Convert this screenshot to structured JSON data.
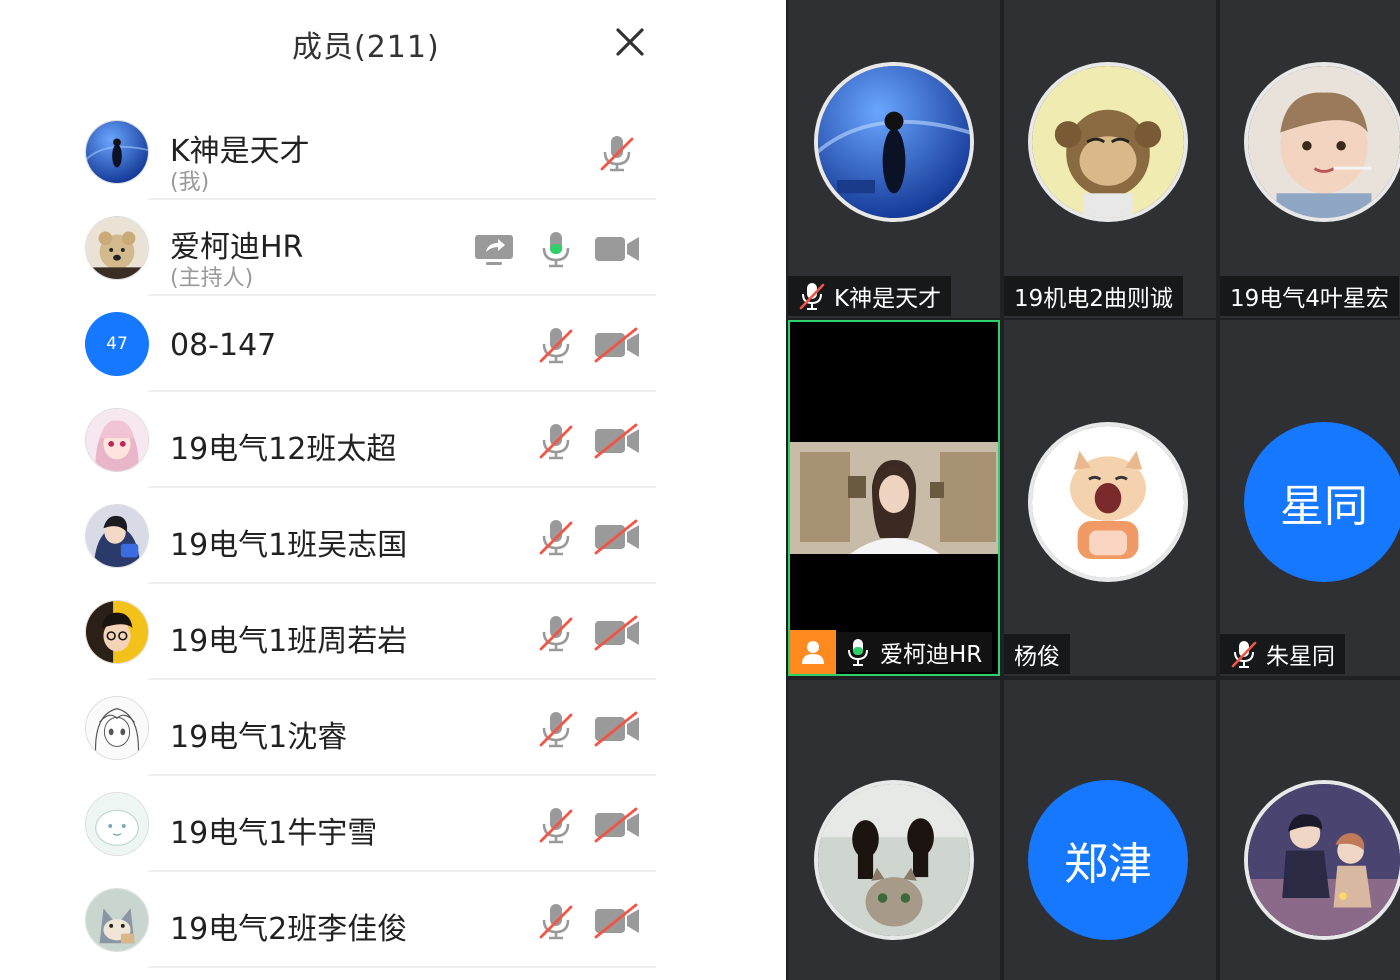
{
  "members_panel": {
    "title": "成员(211)",
    "rows": [
      {
        "name": "K神是天才",
        "role": "(我)",
        "avatar": "avatar-concert-photo",
        "mic": "muted",
        "camera": "none",
        "share": false
      },
      {
        "name": "爱柯迪HR",
        "role": "(主持人)",
        "avatar": "avatar-teddy-bear",
        "mic": "on",
        "camera": "on",
        "share": true
      },
      {
        "name": "08-147",
        "role": "",
        "avatar_text": "47",
        "mic": "muted",
        "camera": "off",
        "share": false
      },
      {
        "name": "19电气12班太超",
        "role": "",
        "avatar": "avatar-anime-girl-pink",
        "mic": "muted",
        "camera": "off",
        "share": false
      },
      {
        "name": "19电气1班吴志国",
        "role": "",
        "avatar": "avatar-anime-boy-dark",
        "mic": "muted",
        "camera": "off",
        "share": false
      },
      {
        "name": "19电气1班周若岩",
        "role": "",
        "avatar": "avatar-cartoon-glasses",
        "mic": "muted",
        "camera": "off",
        "share": false
      },
      {
        "name": "19电气1沈睿",
        "role": "",
        "avatar": "avatar-sketch-girl",
        "mic": "muted",
        "camera": "off",
        "share": false
      },
      {
        "name": "19电气1牛宇雪",
        "role": "",
        "avatar": "avatar-white-blob",
        "mic": "muted",
        "camera": "off",
        "share": false
      },
      {
        "name": "19电气2班李佳俊",
        "role": "",
        "avatar": "avatar-tom-cat",
        "mic": "muted",
        "camera": "off",
        "share": false
      }
    ]
  },
  "video_grid": {
    "tiles": [
      {
        "label": "K神是天才",
        "mic": "muted",
        "avatar": "avatar-concert-photo"
      },
      {
        "label": "19机电2曲则诚",
        "mic": "none",
        "avatar": "avatar-monkey-ape"
      },
      {
        "label": "19电气4叶星宏",
        "mic": "none",
        "avatar": "avatar-toddler"
      },
      {
        "label": "爱柯迪HR",
        "mic": "on",
        "video": "live-video-hr",
        "host": true
      },
      {
        "label": "杨俊",
        "mic": "none",
        "avatar": "avatar-yawning-cat"
      },
      {
        "label": "朱星同",
        "mic": "muted",
        "avatar_text": "星同"
      },
      {
        "label": "",
        "mic": "none",
        "avatar": "avatar-dogs-cat"
      },
      {
        "label": "",
        "mic": "none",
        "avatar_text": "郑津"
      },
      {
        "label": "",
        "mic": "none",
        "avatar": "avatar-anime-couple"
      }
    ]
  },
  "colors": {
    "accent_blue": "#1677ff",
    "muted_red": "#f05545",
    "mic_on_green": "#2fcf6a",
    "icon_gray": "#9a9a9a",
    "grid_bg": "#2e3033",
    "host_orange": "#ff8a1f"
  }
}
